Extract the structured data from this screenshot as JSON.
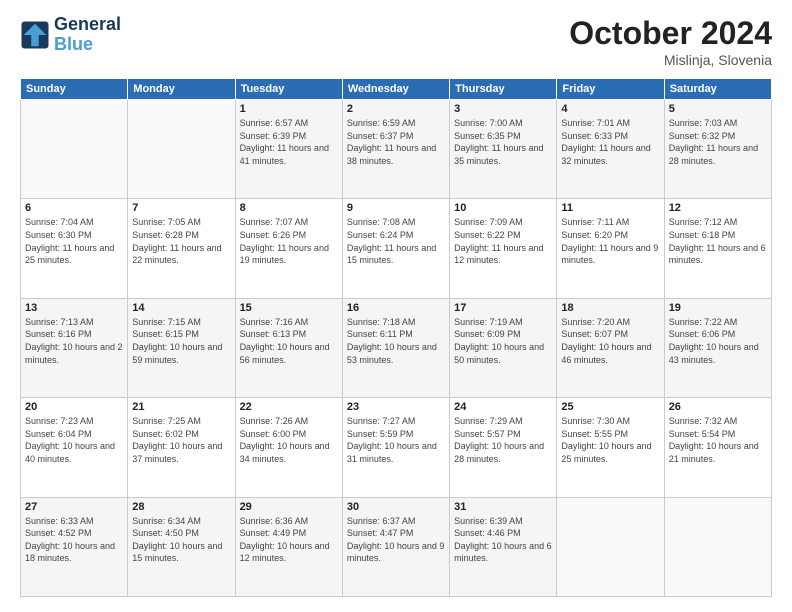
{
  "header": {
    "logo_line1": "General",
    "logo_line2": "Blue",
    "month": "October 2024",
    "location": "Mislinja, Slovenia"
  },
  "days_of_week": [
    "Sunday",
    "Monday",
    "Tuesday",
    "Wednesday",
    "Thursday",
    "Friday",
    "Saturday"
  ],
  "weeks": [
    [
      {
        "day": "",
        "info": ""
      },
      {
        "day": "",
        "info": ""
      },
      {
        "day": "1",
        "sunrise": "6:57 AM",
        "sunset": "6:39 PM",
        "daylight": "11 hours and 41 minutes."
      },
      {
        "day": "2",
        "sunrise": "6:59 AM",
        "sunset": "6:37 PM",
        "daylight": "11 hours and 38 minutes."
      },
      {
        "day": "3",
        "sunrise": "7:00 AM",
        "sunset": "6:35 PM",
        "daylight": "11 hours and 35 minutes."
      },
      {
        "day": "4",
        "sunrise": "7:01 AM",
        "sunset": "6:33 PM",
        "daylight": "11 hours and 32 minutes."
      },
      {
        "day": "5",
        "sunrise": "7:03 AM",
        "sunset": "6:32 PM",
        "daylight": "11 hours and 28 minutes."
      }
    ],
    [
      {
        "day": "6",
        "sunrise": "7:04 AM",
        "sunset": "6:30 PM",
        "daylight": "11 hours and 25 minutes."
      },
      {
        "day": "7",
        "sunrise": "7:05 AM",
        "sunset": "6:28 PM",
        "daylight": "11 hours and 22 minutes."
      },
      {
        "day": "8",
        "sunrise": "7:07 AM",
        "sunset": "6:26 PM",
        "daylight": "11 hours and 19 minutes."
      },
      {
        "day": "9",
        "sunrise": "7:08 AM",
        "sunset": "6:24 PM",
        "daylight": "11 hours and 15 minutes."
      },
      {
        "day": "10",
        "sunrise": "7:09 AM",
        "sunset": "6:22 PM",
        "daylight": "11 hours and 12 minutes."
      },
      {
        "day": "11",
        "sunrise": "7:11 AM",
        "sunset": "6:20 PM",
        "daylight": "11 hours and 9 minutes."
      },
      {
        "day": "12",
        "sunrise": "7:12 AM",
        "sunset": "6:18 PM",
        "daylight": "11 hours and 6 minutes."
      }
    ],
    [
      {
        "day": "13",
        "sunrise": "7:13 AM",
        "sunset": "6:16 PM",
        "daylight": "10 hours and 2 minutes."
      },
      {
        "day": "14",
        "sunrise": "7:15 AM",
        "sunset": "6:15 PM",
        "daylight": "10 hours and 59 minutes."
      },
      {
        "day": "15",
        "sunrise": "7:16 AM",
        "sunset": "6:13 PM",
        "daylight": "10 hours and 56 minutes."
      },
      {
        "day": "16",
        "sunrise": "7:18 AM",
        "sunset": "6:11 PM",
        "daylight": "10 hours and 53 minutes."
      },
      {
        "day": "17",
        "sunrise": "7:19 AM",
        "sunset": "6:09 PM",
        "daylight": "10 hours and 50 minutes."
      },
      {
        "day": "18",
        "sunrise": "7:20 AM",
        "sunset": "6:07 PM",
        "daylight": "10 hours and 46 minutes."
      },
      {
        "day": "19",
        "sunrise": "7:22 AM",
        "sunset": "6:06 PM",
        "daylight": "10 hours and 43 minutes."
      }
    ],
    [
      {
        "day": "20",
        "sunrise": "7:23 AM",
        "sunset": "6:04 PM",
        "daylight": "10 hours and 40 minutes."
      },
      {
        "day": "21",
        "sunrise": "7:25 AM",
        "sunset": "6:02 PM",
        "daylight": "10 hours and 37 minutes."
      },
      {
        "day": "22",
        "sunrise": "7:26 AM",
        "sunset": "6:00 PM",
        "daylight": "10 hours and 34 minutes."
      },
      {
        "day": "23",
        "sunrise": "7:27 AM",
        "sunset": "5:59 PM",
        "daylight": "10 hours and 31 minutes."
      },
      {
        "day": "24",
        "sunrise": "7:29 AM",
        "sunset": "5:57 PM",
        "daylight": "10 hours and 28 minutes."
      },
      {
        "day": "25",
        "sunrise": "7:30 AM",
        "sunset": "5:55 PM",
        "daylight": "10 hours and 25 minutes."
      },
      {
        "day": "26",
        "sunrise": "7:32 AM",
        "sunset": "5:54 PM",
        "daylight": "10 hours and 21 minutes."
      }
    ],
    [
      {
        "day": "27",
        "sunrise": "6:33 AM",
        "sunset": "4:52 PM",
        "daylight": "10 hours and 18 minutes."
      },
      {
        "day": "28",
        "sunrise": "6:34 AM",
        "sunset": "4:50 PM",
        "daylight": "10 hours and 15 minutes."
      },
      {
        "day": "29",
        "sunrise": "6:36 AM",
        "sunset": "4:49 PM",
        "daylight": "10 hours and 12 minutes."
      },
      {
        "day": "30",
        "sunrise": "6:37 AM",
        "sunset": "4:47 PM",
        "daylight": "10 hours and 9 minutes."
      },
      {
        "day": "31",
        "sunrise": "6:39 AM",
        "sunset": "4:46 PM",
        "daylight": "10 hours and 6 minutes."
      },
      {
        "day": "",
        "info": ""
      },
      {
        "day": "",
        "info": ""
      }
    ]
  ]
}
